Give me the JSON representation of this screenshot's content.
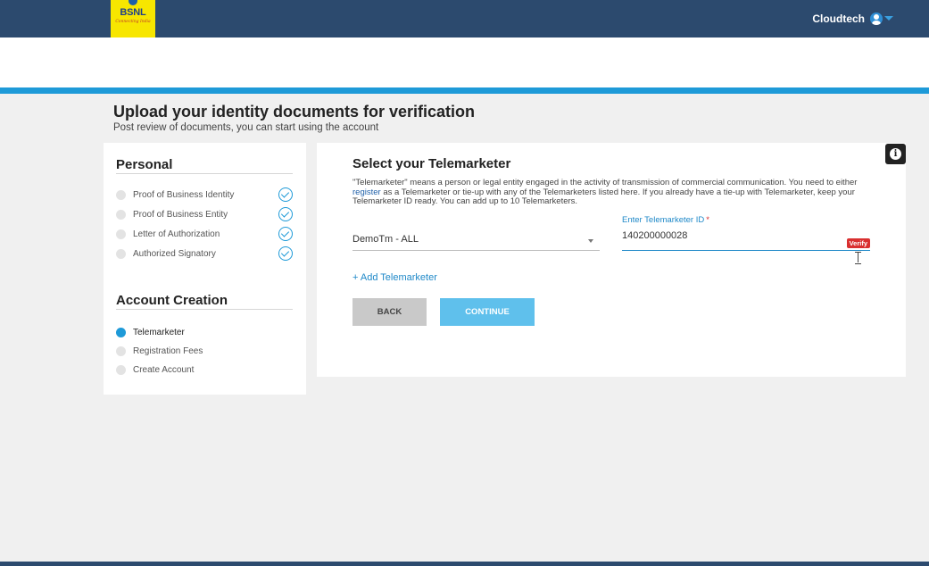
{
  "header": {
    "logo": {
      "brand": "BSNL",
      "tagline": "Connecting India"
    },
    "user": {
      "name": "Cloudtech",
      "icon": "user-circle-icon",
      "menu_icon": "caret-down-icon"
    }
  },
  "page": {
    "title": "Upload your identity documents for verification",
    "subtitle": "Post review of documents, you can start using the account"
  },
  "sidebar": {
    "personal": {
      "heading": "Personal",
      "steps": [
        {
          "label": "Proof of Business Identity",
          "completed": true
        },
        {
          "label": "Proof of Business Entity",
          "completed": true
        },
        {
          "label": "Letter of Authorization",
          "completed": true
        },
        {
          "label": "Authorized Signatory",
          "completed": true
        }
      ]
    },
    "account_creation": {
      "heading": "Account Creation",
      "steps": [
        {
          "label": "Telemarketer",
          "active": true
        },
        {
          "label": "Registration Fees",
          "active": false
        },
        {
          "label": "Create Account",
          "active": false
        }
      ]
    }
  },
  "main": {
    "info_icon": "info-icon",
    "title": "Select your Telemarketer",
    "description": {
      "before_link": "\"Telemarketer\" means a person or legal entity engaged in the activity of transmission of commercial communication. You need to either ",
      "link": "register",
      "after_link": " as a Telemarketer or tie-up with any of the Telemarketers listed here. If you already have a tie-up with Telemarketer, keep your Telemarketer ID ready. You can add up to 10 Telemarketers."
    },
    "telemarketer_select": {
      "value": "DemoTm - ALL"
    },
    "telemarketer_id": {
      "label": "Enter Telemarketer ID",
      "required_mark": "*",
      "value": "140200000028",
      "verify_label": "Verify"
    },
    "add_link": "+ Add Telemarketer",
    "back_label": "BACK",
    "continue_label": "CONTINUE"
  },
  "colors": {
    "header_bg": "#2c4a6e",
    "accent": "#1e9ad8",
    "logo_bg": "#f7e600",
    "verify_badge": "#d93030",
    "continue_button": "#5fc0ec"
  }
}
